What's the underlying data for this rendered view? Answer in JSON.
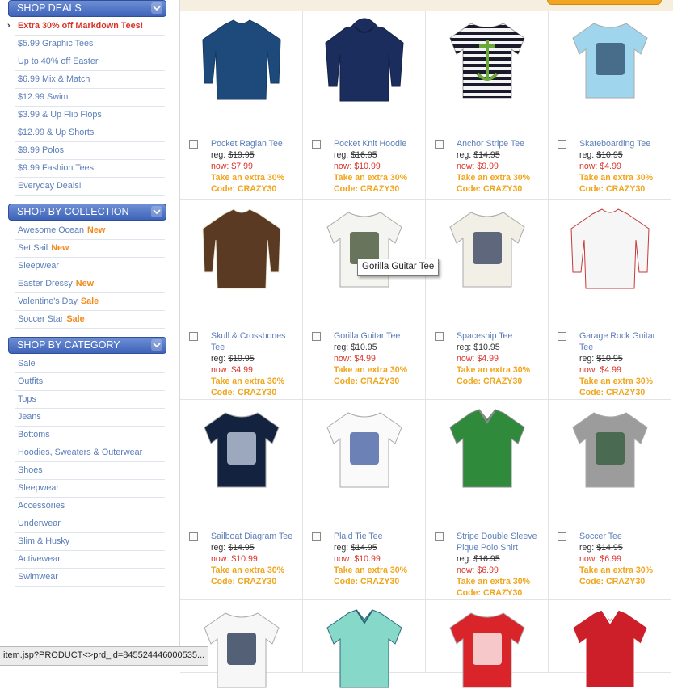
{
  "sidebar": {
    "deals": {
      "title": "SHOP DEALS",
      "items": [
        {
          "label": "Extra 30% off Markdown Tees!",
          "hot": true
        },
        {
          "label": "$5.99 Graphic Tees"
        },
        {
          "label": "Up to 40% off Easter"
        },
        {
          "label": "$6.99 Mix & Match"
        },
        {
          "label": "$12.99 Swim"
        },
        {
          "label": "$3.99 & Up Flip Flops"
        },
        {
          "label": "$12.99 & Up Shorts"
        },
        {
          "label": "$9.99 Polos"
        },
        {
          "label": "$9.99 Fashion Tees"
        },
        {
          "label": "Everyday Deals!"
        }
      ]
    },
    "collection": {
      "title": "SHOP BY COLLECTION",
      "items": [
        {
          "label": "Awesome Ocean",
          "tag": "New"
        },
        {
          "label": "Set Sail",
          "tag": "New"
        },
        {
          "label": "Sleepwear"
        },
        {
          "label": "Easter Dressy",
          "tag": "New"
        },
        {
          "label": "Valentine's Day",
          "tag": "Sale"
        },
        {
          "label": "Soccer Star",
          "tag": "Sale"
        }
      ]
    },
    "category": {
      "title": "SHOP BY CATEGORY",
      "items": [
        {
          "label": "Sale"
        },
        {
          "label": "Outfits"
        },
        {
          "label": "Tops"
        },
        {
          "label": "Jeans"
        },
        {
          "label": "Bottoms"
        },
        {
          "label": "Hoodies, Sweaters & Outerwear"
        },
        {
          "label": "Shoes"
        },
        {
          "label": "Sleepwear"
        },
        {
          "label": "Accessories"
        },
        {
          "label": "Underwear"
        },
        {
          "label": "Slim & Husky"
        },
        {
          "label": "Activewear"
        },
        {
          "label": "Swimwear"
        }
      ]
    }
  },
  "promo": {
    "line1": "Take an extra 30%",
    "line2": "Code: CRAZY30"
  },
  "products": [
    {
      "name": "Pocket Raglan Tee",
      "reg": "$19.95",
      "now": "$7.99",
      "colors": [
        "#1d4a7a",
        "#163a62"
      ],
      "kind": "longsleeve"
    },
    {
      "name": "Pocket Knit Hoodie",
      "reg": "$16.95",
      "now": "$10.99",
      "colors": [
        "#1b2d5c",
        "#132146"
      ],
      "kind": "hoodie"
    },
    {
      "name": "Anchor Stripe Tee",
      "reg": "$14.95",
      "now": "$9.99",
      "colors": [
        "#f4f4f4",
        "#1a1a2a"
      ],
      "kind": "stripes"
    },
    {
      "name": "Skateboarding Tee",
      "reg": "$10.95",
      "now": "$4.99",
      "colors": [
        "#9fd6ee",
        "#2a4a6a"
      ],
      "kind": "tee"
    },
    {
      "name": "Skull & Crossbones Tee",
      "reg": "$10.95",
      "now": "$4.99",
      "colors": [
        "#5a3a22",
        "#e8e4cf"
      ],
      "kind": "longsleeve"
    },
    {
      "name": "Gorilla Guitar Tee",
      "reg": "$10.95",
      "now": "$4.99",
      "colors": [
        "#f4f4f0",
        "#3a4a2a"
      ],
      "kind": "tee"
    },
    {
      "name": "Spaceship Tee",
      "reg": "$10.95",
      "now": "$4.99",
      "colors": [
        "#f1efe6",
        "#2d3a5a"
      ],
      "kind": "tee"
    },
    {
      "name": "Garage Rock Guitar Tee",
      "reg": "$10.95",
      "now": "$4.99",
      "colors": [
        "#f6f6f6",
        "#c23a3a"
      ],
      "kind": "longsleeve"
    },
    {
      "name": "Sailboat Diagram Tee",
      "reg": "$14.95",
      "now": "$10.99",
      "colors": [
        "#13233f",
        "#c9d6ea"
      ],
      "kind": "tee"
    },
    {
      "name": "Plaid Tie Tee",
      "reg": "$14.95",
      "now": "$10.99",
      "colors": [
        "#fafafa",
        "#3c5aa0"
      ],
      "kind": "tee"
    },
    {
      "name": "Stripe Double Sleeve Pique Polo Shirt",
      "reg": "$16.95",
      "now": "$6.99",
      "colors": [
        "#2f8a3c",
        "#8a8a8a"
      ],
      "kind": "polo"
    },
    {
      "name": "Soccer Tee",
      "reg": "$14.95",
      "now": "$6.99",
      "colors": [
        "#9c9c9c",
        "#2f5a3a"
      ],
      "kind": "tee"
    },
    {
      "name": "",
      "reg": "",
      "now": "",
      "colors": [
        "#f7f7f7",
        "#1d2d4a"
      ],
      "kind": "tee"
    },
    {
      "name": "",
      "reg": "",
      "now": "",
      "colors": [
        "#86d8c8",
        "#2c6a7a"
      ],
      "kind": "polo"
    },
    {
      "name": "",
      "reg": "",
      "now": "",
      "colors": [
        "#d9242a",
        "#ffffff"
      ],
      "kind": "tee"
    },
    {
      "name": "",
      "reg": "",
      "now": "",
      "colors": [
        "#cc1f2a",
        "#ffffff"
      ],
      "kind": "polo"
    }
  ],
  "labels": {
    "reg": "reg:",
    "now": "now:"
  },
  "tooltip": "Gorilla Guitar Tee",
  "statusbar": "item.jsp?PRODUCT<>prd_id=845524446000535...",
  "colors": {
    "accent": "#3f63b8",
    "link": "#5a7eb8",
    "sale": "#d9342a",
    "promo": "#f0a51c"
  }
}
